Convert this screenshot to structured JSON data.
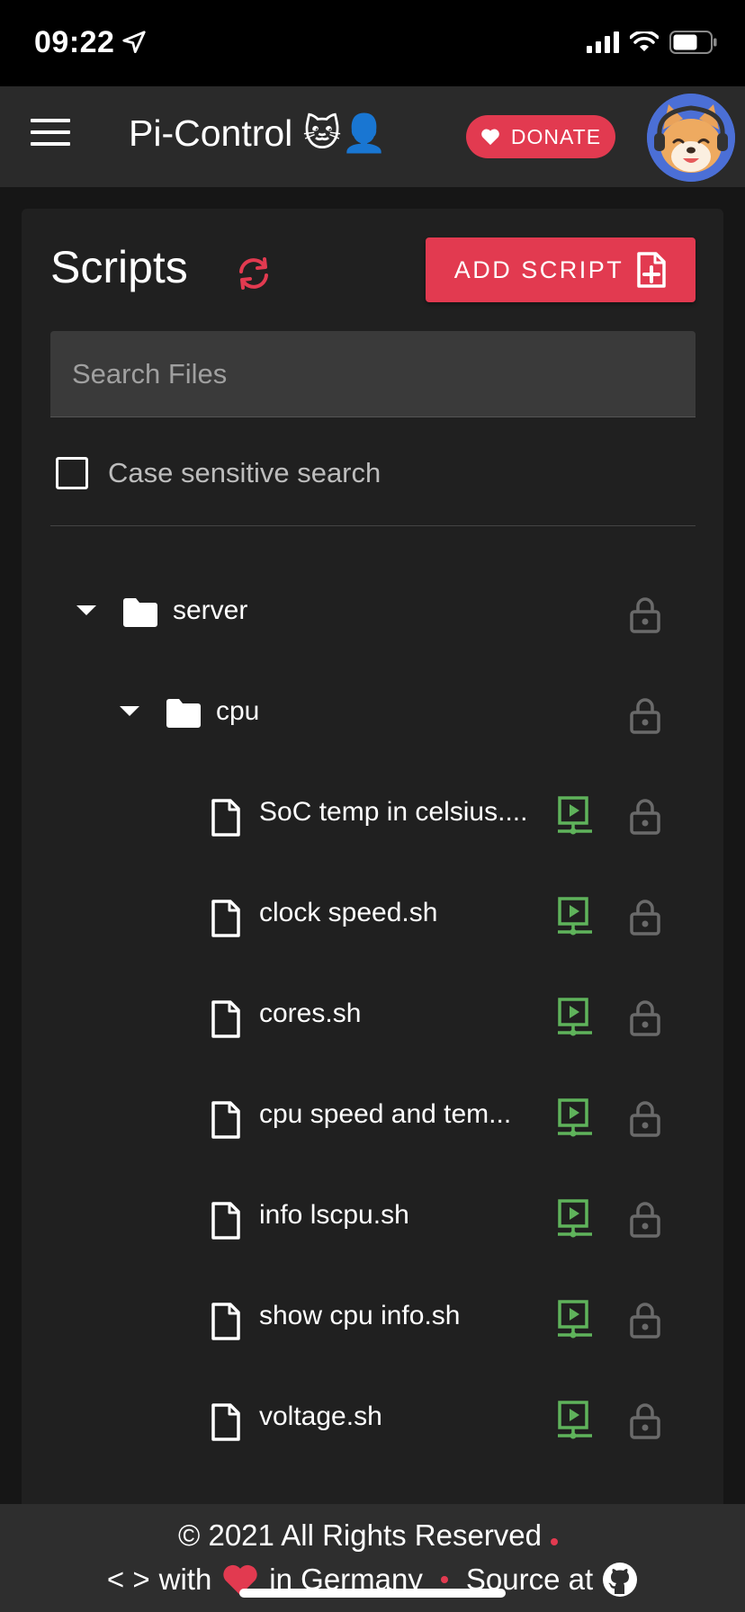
{
  "status_bar": {
    "time": "09:22"
  },
  "app_bar": {
    "title": "Pi-Control 🐱👤",
    "donate_label": "DONATE"
  },
  "scripts": {
    "title": "Scripts",
    "add_label": "ADD SCRIPT",
    "search_placeholder": "Search Files",
    "case_label": "Case sensitive search"
  },
  "tree": {
    "folders": [
      {
        "name": "server"
      },
      {
        "name": "cpu"
      }
    ],
    "files": [
      {
        "name": "SoC temp in celsius...."
      },
      {
        "name": "clock speed.sh"
      },
      {
        "name": "cores.sh"
      },
      {
        "name": "cpu speed and tem..."
      },
      {
        "name": "info lscpu.sh"
      },
      {
        "name": "show cpu info.sh"
      },
      {
        "name": "voltage.sh"
      }
    ]
  },
  "footer": {
    "copyright": "© 2021 All Rights Reserved",
    "code_glyph": "< >",
    "with": "with",
    "in_germany": "in Germany",
    "source_at": "Source at"
  },
  "colors": {
    "accent": "#e23a50",
    "run_green": "#5fb35b",
    "lock_grey": "#6a6a6a",
    "card_bg": "#202020",
    "appbar_bg": "#2a2a2a"
  }
}
